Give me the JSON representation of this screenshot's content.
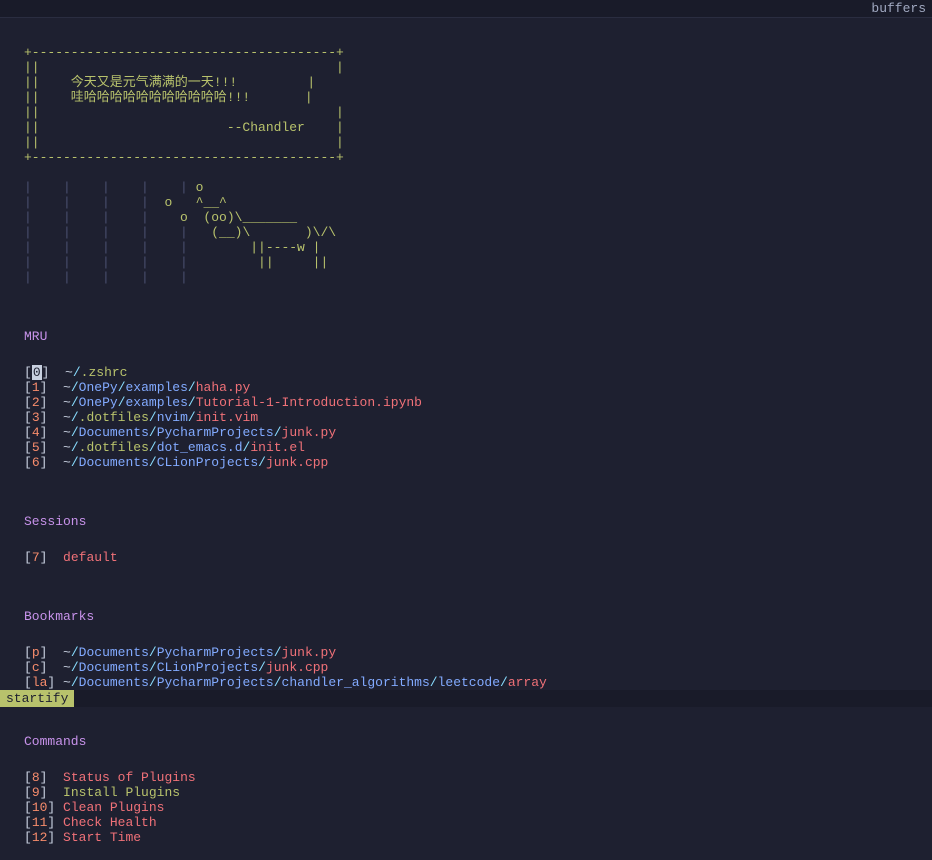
{
  "topbar": {
    "label": "buffers"
  },
  "ascii_header": [
    "+---------------------------------------+",
    "||                                      |",
    "||    今天又是元气满满的一天!!!         |",
    "||    哇哈哈哈哈哈哈哈哈哈哈哈!!!       |",
    "||                                      |",
    "||                        --Chandler    |",
    "||                                      |",
    "+---------------------------------------+"
  ],
  "ascii_cow_dim": [
    "|    |    |    |    | ",
    "|    |    |    |  ",
    "|    |    |    |    ",
    "|    |    |    |    | ",
    "|    |    |    |    |  ",
    "|    |    |    |    |   ",
    "|    |    |    |    |   "
  ],
  "ascii_cow_green": [
    "o",
    "o   ^__^",
    "o  (oo)\\_______",
    "  (__)\\       )\\/\\",
    "      ||----w |",
    "      ||     ||",
    ""
  ],
  "sections": {
    "mru": "MRU",
    "sessions": "Sessions",
    "bookmarks": "Bookmarks",
    "commands": "Commands"
  },
  "mru": [
    {
      "key": "0",
      "cursor": true,
      "segs": [
        "~",
        "/",
        ".zshrc"
      ],
      "types": [
        "tilde",
        "sep",
        "dot"
      ]
    },
    {
      "key": "1",
      "cursor": false,
      "segs": [
        "~",
        "/",
        "OnePy",
        "/",
        "examples",
        "/",
        "haha.py"
      ],
      "types": [
        "tilde",
        "sep",
        "dir",
        "sep",
        "dir",
        "sep",
        "file"
      ]
    },
    {
      "key": "2",
      "cursor": false,
      "segs": [
        "~",
        "/",
        "OnePy",
        "/",
        "examples",
        "/",
        "Tutorial-1-Introduction.ipynb"
      ],
      "types": [
        "tilde",
        "sep",
        "dir",
        "sep",
        "dir",
        "sep",
        "file"
      ]
    },
    {
      "key": "3",
      "cursor": false,
      "segs": [
        "~",
        "/",
        ".dotfiles",
        "/",
        "nvim",
        "/",
        "init.vim"
      ],
      "types": [
        "tilde",
        "sep",
        "dot",
        "sep",
        "dir",
        "sep",
        "file"
      ]
    },
    {
      "key": "4",
      "cursor": false,
      "segs": [
        "~",
        "/",
        "Documents",
        "/",
        "PycharmProjects",
        "/",
        "junk.py"
      ],
      "types": [
        "tilde",
        "sep",
        "dir",
        "sep",
        "dir",
        "sep",
        "file"
      ]
    },
    {
      "key": "5",
      "cursor": false,
      "segs": [
        "~",
        "/",
        ".dotfiles",
        "/",
        "dot_emacs.d",
        "/",
        "init.el"
      ],
      "types": [
        "tilde",
        "sep",
        "dot",
        "sep",
        "dir",
        "sep",
        "file"
      ]
    },
    {
      "key": "6",
      "cursor": false,
      "segs": [
        "~",
        "/",
        "Documents",
        "/",
        "CLionProjects",
        "/",
        "junk.cpp"
      ],
      "types": [
        "tilde",
        "sep",
        "dir",
        "sep",
        "dir",
        "sep",
        "file"
      ]
    }
  ],
  "sessions": [
    {
      "key": "7",
      "label": "default"
    }
  ],
  "bookmarks": [
    {
      "key": "p",
      "segs": [
        "~",
        "/",
        "Documents",
        "/",
        "PycharmProjects",
        "/",
        "junk.py"
      ],
      "types": [
        "tilde",
        "sep",
        "dir",
        "sep",
        "dir",
        "sep",
        "file"
      ]
    },
    {
      "key": "c",
      "segs": [
        "~",
        "/",
        "Documents",
        "/",
        "CLionProjects",
        "/",
        "junk.cpp"
      ],
      "types": [
        "tilde",
        "sep",
        "dir",
        "sep",
        "dir",
        "sep",
        "file"
      ]
    },
    {
      "key": "la",
      "segs": [
        "~",
        "/",
        "Documents",
        "/",
        "PycharmProjects",
        "/",
        "chandler_algorithms",
        "/",
        "leetcode",
        "/",
        "array"
      ],
      "types": [
        "tilde",
        "sep",
        "dir",
        "sep",
        "dir",
        "sep",
        "dir",
        "sep",
        "dir",
        "sep",
        "file"
      ]
    }
  ],
  "commands": [
    {
      "key": "8",
      "label": "Status of Plugins",
      "green": false
    },
    {
      "key": "9",
      "label": "Install Plugins",
      "green": true
    },
    {
      "key": "10",
      "label": "Clean Plugins",
      "green": false
    },
    {
      "key": "11",
      "label": "Check Health",
      "green": false
    },
    {
      "key": "12",
      "label": "Start Time",
      "green": false
    }
  ],
  "statusline": {
    "mode": "startify"
  }
}
